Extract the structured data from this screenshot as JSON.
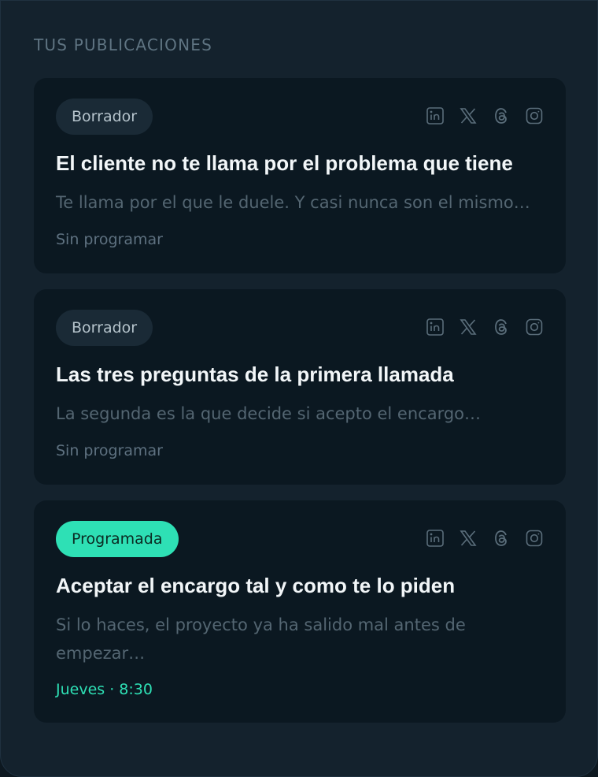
{
  "section": {
    "title": "TUS PUBLICACIONES"
  },
  "colors": {
    "accent": "#2ee0b5",
    "card_bg": "#0b1821",
    "panel_bg": "#14222d"
  },
  "platform_icons": [
    "linkedin-icon",
    "x-icon",
    "threads-icon",
    "instagram-icon"
  ],
  "posts": [
    {
      "badge": "Borrador",
      "title": "El cliente no te llama por el problema que tiene",
      "excerpt": "Te llama por el que le duele. Y casi nunca son el mismo…",
      "status": "Sin programar"
    },
    {
      "badge": "Borrador",
      "title": "Las tres preguntas de la primera llamada",
      "excerpt": "La segunda es la que decide si acepto el encargo…",
      "status": "Sin programar"
    },
    {
      "badge": "Programada",
      "title": "Aceptar el encargo tal y como te lo piden",
      "excerpt": "Si lo haces, el proyecto ya ha salido mal antes de empezar…",
      "status": "Jueves · 8:30"
    }
  ]
}
